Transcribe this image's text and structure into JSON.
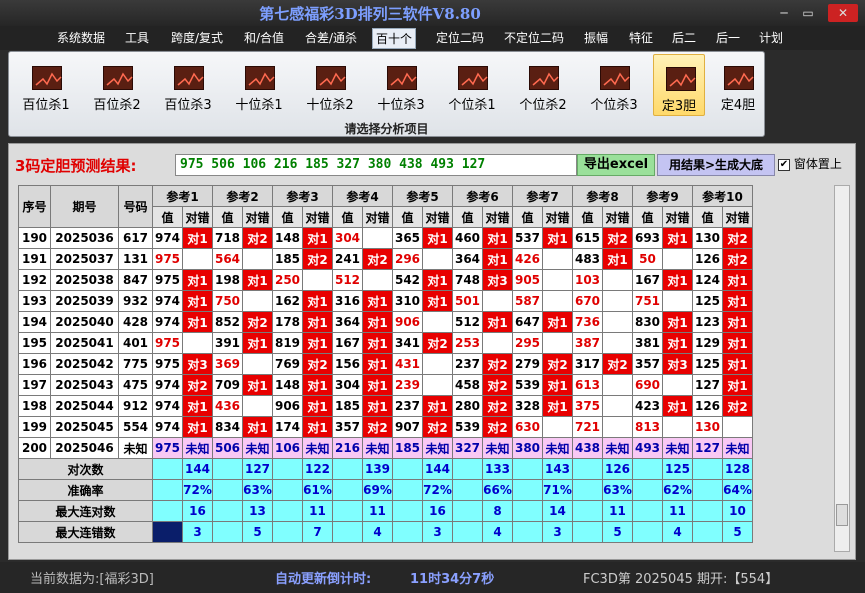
{
  "window": {
    "title": "第七感福彩3D排列三软件V8.80",
    "min": "─",
    "max": "▭",
    "close": "✕"
  },
  "menu": [
    "系统数据",
    "工具",
    "跨度/复式",
    "和/合值",
    "合差/通杀",
    "百十个",
    "定位二码",
    "不定位二码",
    "振幅",
    "特征",
    "后二",
    "后一",
    "计划"
  ],
  "menu_active": "百十个",
  "ribbon": {
    "buttons": [
      "百位杀1",
      "百位杀2",
      "百位杀3",
      "十位杀1",
      "十位杀2",
      "十位杀3",
      "个位杀1",
      "个位杀2",
      "个位杀3",
      "定3胆",
      "定4胆"
    ],
    "selected": "定3胆",
    "caption": "请选择分析项目"
  },
  "result": {
    "label": "3码定胆预测结果:",
    "value": "975 506 106 216 185 327 380 438 493 127"
  },
  "buttons": {
    "export": "导出excel",
    "generate": "用结果>生成大底"
  },
  "topmost": {
    "label": "窗体置上",
    "checked": "✔"
  },
  "table": {
    "headers": {
      "seq": "序号",
      "period": "期号",
      "code": "号码",
      "ref": [
        "参考1",
        "参考2",
        "参考3",
        "参考4",
        "参考5",
        "参考6",
        "参考7",
        "参考8",
        "参考9",
        "参考10"
      ],
      "val": "值",
      "mark": "对错"
    },
    "rows": [
      {
        "seq": "190",
        "period": "2025036",
        "code": "617",
        "vals": [
          "974",
          "718",
          "148",
          "304",
          "365",
          "460",
          "537",
          "615",
          "693",
          "130"
        ],
        "marks": [
          "对1",
          "对2",
          "对1",
          "",
          "对1",
          "对1",
          "对1",
          "对2",
          "对1",
          "对2"
        ]
      },
      {
        "seq": "191",
        "period": "2025037",
        "code": "131",
        "vals": [
          "975",
          "564",
          "185",
          "241",
          "296",
          "364",
          "426",
          "483",
          "50",
          "126"
        ],
        "marks": [
          "",
          "",
          "对2",
          "对2",
          "",
          "对1",
          "",
          "对1",
          "",
          "对2"
        ]
      },
      {
        "seq": "192",
        "period": "2025038",
        "code": "847",
        "vals": [
          "975",
          "198",
          "250",
          "512",
          "542",
          "748",
          "905",
          "103",
          "167",
          "124"
        ],
        "marks": [
          "对1",
          "对1",
          "",
          "",
          "对1",
          "对3",
          "",
          "",
          "对1",
          "对1"
        ]
      },
      {
        "seq": "193",
        "period": "2025039",
        "code": "932",
        "vals": [
          "974",
          "750",
          "162",
          "316",
          "310",
          "501",
          "587",
          "670",
          "751",
          "125"
        ],
        "marks": [
          "对1",
          "",
          "对1",
          "对1",
          "对1",
          "",
          "",
          "",
          "",
          "对1"
        ]
      },
      {
        "seq": "194",
        "period": "2025040",
        "code": "428",
        "vals": [
          "974",
          "852",
          "178",
          "364",
          "906",
          "512",
          "647",
          "736",
          "830",
          "123"
        ],
        "marks": [
          "对1",
          "对2",
          "对1",
          "对1",
          "",
          "对1",
          "对1",
          "",
          "对1",
          "对1"
        ]
      },
      {
        "seq": "195",
        "period": "2025041",
        "code": "401",
        "vals": [
          "975",
          "391",
          "819",
          "167",
          "341",
          "253",
          "295",
          "387",
          "381",
          "129"
        ],
        "marks": [
          "",
          "对1",
          "对1",
          "对1",
          "对2",
          "",
          "",
          "",
          "对1",
          "对1"
        ]
      },
      {
        "seq": "196",
        "period": "2025042",
        "code": "775",
        "vals": [
          "975",
          "369",
          "769",
          "156",
          "431",
          "237",
          "279",
          "317",
          "357",
          "125"
        ],
        "marks": [
          "对3",
          "",
          "对2",
          "对1",
          "",
          "对2",
          "对2",
          "对2",
          "对3",
          "对1"
        ]
      },
      {
        "seq": "197",
        "period": "2025043",
        "code": "475",
        "vals": [
          "974",
          "709",
          "148",
          "304",
          "239",
          "458",
          "539",
          "613",
          "690",
          "127"
        ],
        "marks": [
          "对2",
          "对1",
          "对1",
          "对1",
          "",
          "对2",
          "对1",
          "",
          "",
          "对1"
        ]
      },
      {
        "seq": "198",
        "period": "2025044",
        "code": "912",
        "vals": [
          "974",
          "436",
          "906",
          "185",
          "237",
          "280",
          "328",
          "375",
          "423",
          "126"
        ],
        "marks": [
          "对1",
          "",
          "对1",
          "对1",
          "对1",
          "对2",
          "对1",
          "",
          "对1",
          "对2"
        ]
      },
      {
        "seq": "199",
        "period": "2025045",
        "code": "554",
        "vals": [
          "974",
          "834",
          "174",
          "357",
          "907",
          "539",
          "630",
          "721",
          "813",
          "130"
        ],
        "marks": [
          "对1",
          "对1",
          "对1",
          "对2",
          "对2",
          "对2",
          "",
          "",
          "",
          ""
        ]
      }
    ],
    "forecast": {
      "seq": "200",
      "period": "2025046",
      "code": "未知",
      "vals": [
        "975",
        "506",
        "106",
        "216",
        "185",
        "327",
        "380",
        "438",
        "493",
        "127"
      ],
      "mark": "未知"
    },
    "stats": [
      {
        "label": "对次数",
        "values": [
          "144",
          "127",
          "122",
          "139",
          "144",
          "133",
          "143",
          "126",
          "125",
          "128"
        ]
      },
      {
        "label": "准确率",
        "values": [
          "72%",
          "63%",
          "61%",
          "69%",
          "72%",
          "66%",
          "71%",
          "63%",
          "62%",
          "64%"
        ]
      },
      {
        "label": "最大连对数",
        "values": [
          "16",
          "13",
          "11",
          "11",
          "16",
          "8",
          "14",
          "11",
          "11",
          "10"
        ]
      },
      {
        "label": "最大连错数",
        "values": [
          "3",
          "5",
          "7",
          "4",
          "3",
          "4",
          "3",
          "5",
          "4",
          "5"
        ]
      }
    ]
  },
  "status": {
    "current": "当前数据为:[福彩3D]",
    "countdown_label": "自动更新倒计时:",
    "countdown": "11时34分7秒",
    "issue": "FC3D第 2025045 期开:【554】"
  },
  "colors": {
    "hit": "#e80000",
    "stat_bg": "#80ffff",
    "forecast_bg": "#f8c8f4",
    "title": "#7d9fff"
  }
}
